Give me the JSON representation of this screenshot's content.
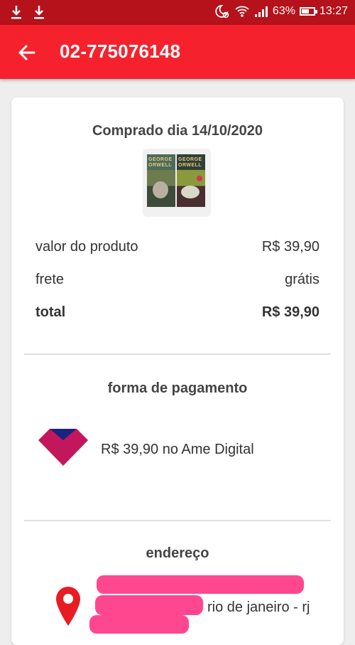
{
  "status_bar": {
    "battery": "63%",
    "battery_level": 0.63,
    "time": "13:27",
    "left_icons": [
      "download-icon",
      "download-icon"
    ],
    "right_icons": [
      "night-alarm-icon",
      "wifi-icon",
      "signal-icon",
      "battery-icon"
    ]
  },
  "app_bar": {
    "title": "02-775076148",
    "back_icon": "arrow-left-icon",
    "color": "#f5222d"
  },
  "order": {
    "purchased_label": "Comprado dia 14/10/2020",
    "product_image": "product-thumbnail",
    "book_cover_text": [
      "GEORGE ORWELL",
      "GEORGE ORWELL"
    ],
    "rows": [
      {
        "label": "valor do produto",
        "value": "R$ 39,90"
      },
      {
        "label": "frete",
        "value": "grátis"
      },
      {
        "label": "total",
        "value": "R$ 39,90"
      }
    ]
  },
  "payment": {
    "title": "forma de pagamento",
    "icon": "ame-digital-icon",
    "text": "R$ 39,90 no Ame Digital"
  },
  "address": {
    "title": "endereço",
    "icon": "location-pin-icon",
    "city": "rio de janeiro - rj"
  }
}
